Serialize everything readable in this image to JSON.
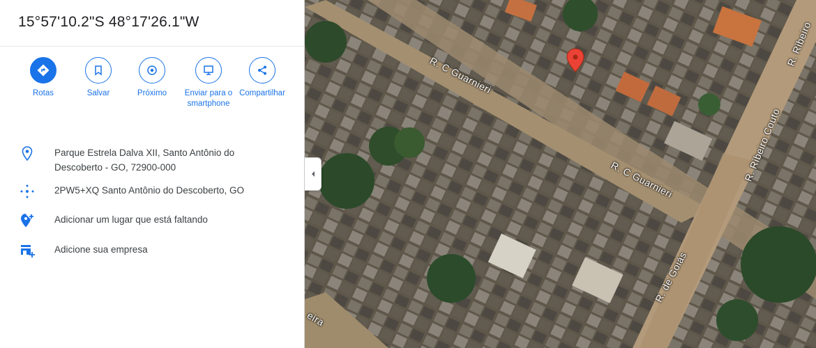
{
  "coordinates": "15°57'10.2\"S 48°17'26.1\"W",
  "actions": [
    {
      "label": "Rotas",
      "icon": "directions-icon"
    },
    {
      "label": "Salvar",
      "icon": "bookmark-icon"
    },
    {
      "label": "Próximo",
      "icon": "nearby-icon"
    },
    {
      "label": "Enviar para o smartphone",
      "icon": "send-to-phone-icon"
    },
    {
      "label": "Compartilhar",
      "icon": "share-icon"
    }
  ],
  "info": {
    "address": "Parque Estrela Dalva XII, Santo Antônio do Descoberto - GO, 72900-000",
    "plus_code": "2PW5+XQ Santo Antônio do Descoberto, GO",
    "add_place": "Adicionar um lugar que está faltando",
    "add_business": "Adicione sua empresa"
  },
  "map": {
    "road_labels": [
      "R. C Guarnieri",
      "R. C Guarnieri",
      "R. Ribeiro Couto",
      "R. de Goiás",
      "R. Ribeiro",
      "eira"
    ],
    "pin_color": "#ea4335"
  },
  "colors": {
    "accent": "#1a73e8"
  }
}
